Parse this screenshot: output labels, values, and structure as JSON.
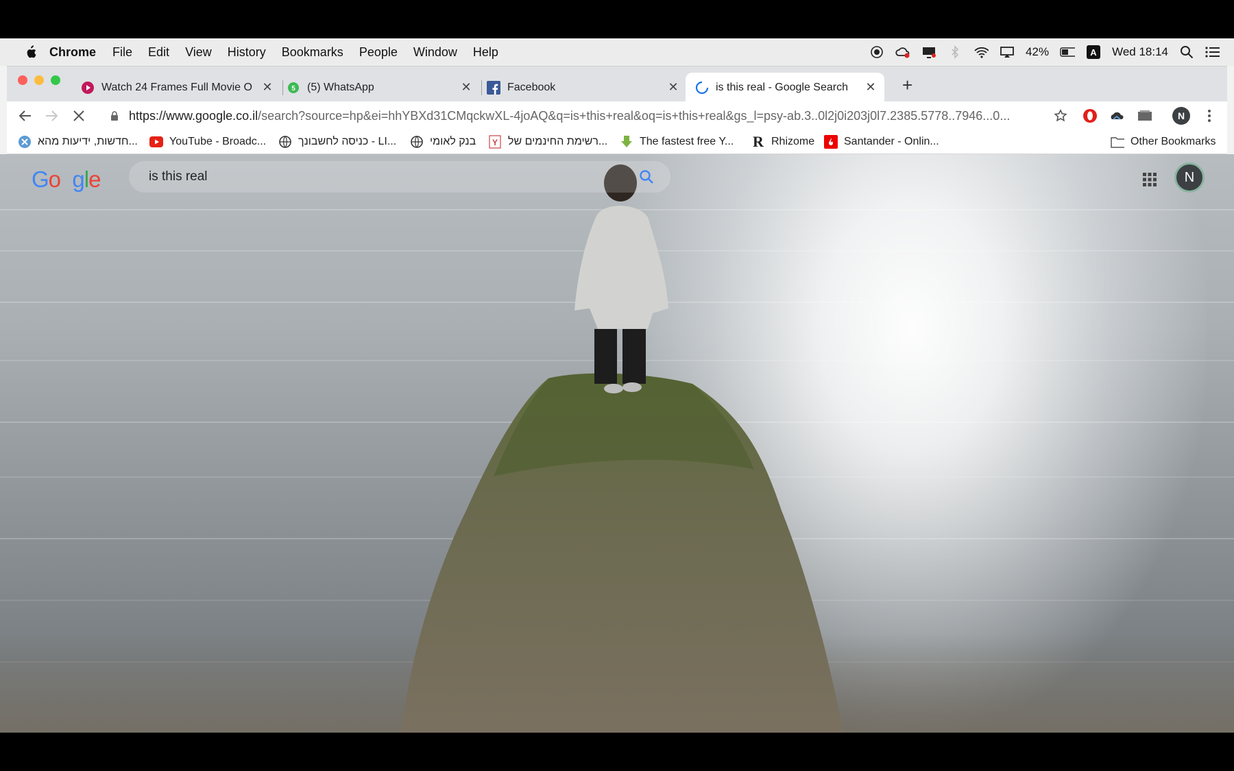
{
  "menubar": {
    "app": "Chrome",
    "items": [
      "File",
      "Edit",
      "View",
      "History",
      "Bookmarks",
      "People",
      "Window",
      "Help"
    ],
    "battery": "42%",
    "clock": "Wed 18:14"
  },
  "tabs": [
    {
      "title": "Watch 24 Frames Full Movie O",
      "favicon": "play-icon",
      "active": false
    },
    {
      "title": "(5) WhatsApp",
      "favicon": "whatsapp-icon",
      "active": false
    },
    {
      "title": "Facebook",
      "favicon": "facebook-icon",
      "active": false
    },
    {
      "title": "is this real - Google Search",
      "favicon": "loading-spinner-icon",
      "active": true
    }
  ],
  "toolbar": {
    "url_host": "https://www.google.co.il",
    "url_rest": "/search?source=hp&ei=hhYBXd31CMqckwXL-4joAQ&q=is+this+real&oq=is+this+real&gs_l=psy-ab.3..0l2j0i203j0l7.2385.5778..7946...0...",
    "profile_initial": "N"
  },
  "bookmarks": [
    {
      "label": "חדשות, ידיעות מהא...",
      "icon": "x-icon"
    },
    {
      "label": "YouTube - Broadc...",
      "icon": "youtube-icon"
    },
    {
      "label": "כניסה לחשבונך - LI...",
      "icon": "globe-icon"
    },
    {
      "label": "בנק לאומי",
      "icon": "globe-icon"
    },
    {
      "label": "רשימת החינמים של...",
      "icon": "y-icon"
    },
    {
      "label": "The fastest free Y...",
      "icon": "download-icon"
    },
    {
      "label": "Rhizome",
      "icon": "r-icon"
    },
    {
      "label": "Santander - Onlin...",
      "icon": "santander-icon"
    },
    {
      "label": "Other Bookmarks",
      "icon": "folder-icon"
    }
  ],
  "google": {
    "query": "is this real",
    "avatar_initial": "N"
  }
}
